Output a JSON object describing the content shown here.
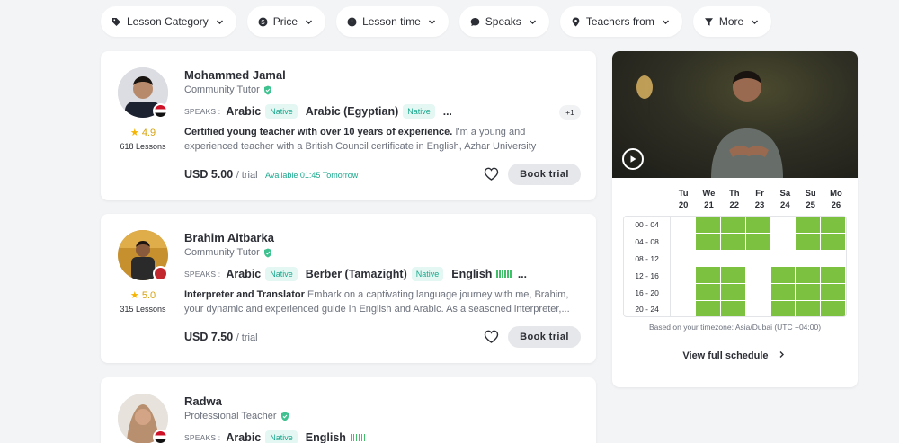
{
  "filters": [
    {
      "label": "Lesson Category",
      "icon": "tag-icon"
    },
    {
      "label": "Price",
      "icon": "coin-icon"
    },
    {
      "label": "Lesson time",
      "icon": "clock-icon"
    },
    {
      "label": "Speaks",
      "icon": "chat-icon"
    },
    {
      "label": "Teachers from",
      "icon": "location-pin-icon"
    },
    {
      "label": "More",
      "icon": "filter-icon"
    }
  ],
  "tutors": [
    {
      "name": "Mohammed Jamal",
      "type": "Community Tutor",
      "rating": "4.9",
      "lessons": "618 Lessons",
      "speaks_label": "SPEAKS :",
      "languages": [
        {
          "name": "Arabic",
          "level": "Native"
        },
        {
          "name": "Arabic (Egyptian)",
          "level": "Native"
        }
      ],
      "ellipsis": "...",
      "more_count": "+1",
      "headline": "Certified young teacher with over 10 years of experience.",
      "description": "I'm a young and experienced teacher with a British Council certificate in English, Azhar University graduation certifica...",
      "price": "USD 5.00",
      "price_unit": "/ trial",
      "availability": "Available 01:45 Tomorrow",
      "book_label": "Book trial"
    },
    {
      "name": "Brahim Aitbarka",
      "type": "Community Tutor",
      "rating": "5.0",
      "lessons": "315 Lessons",
      "speaks_label": "SPEAKS :",
      "languages": [
        {
          "name": "Arabic",
          "level": "Native"
        },
        {
          "name": "Berber (Tamazight)",
          "level": "Native"
        },
        {
          "name": "English",
          "level": ""
        }
      ],
      "ellipsis": "...",
      "headline": "Interpreter and Translator",
      "description": "Embark on a captivating language journey with me, Brahim, your dynamic and experienced guide in English and Arabic. As a seasoned interpreter,...",
      "price": "USD 7.50",
      "price_unit": "/ trial",
      "book_label": "Book trial"
    },
    {
      "name": "Radwa",
      "type": "Professional Teacher",
      "speaks_label": "SPEAKS :",
      "languages": [
        {
          "name": "Arabic",
          "level": "Native"
        },
        {
          "name": "English",
          "level": ""
        }
      ]
    }
  ],
  "schedule": {
    "days": [
      {
        "dow": "Tu",
        "date": "20"
      },
      {
        "dow": "We",
        "date": "21"
      },
      {
        "dow": "Th",
        "date": "22"
      },
      {
        "dow": "Fr",
        "date": "23"
      },
      {
        "dow": "Sa",
        "date": "24"
      },
      {
        "dow": "Su",
        "date": "25"
      },
      {
        "dow": "Mo",
        "date": "26"
      }
    ],
    "slots": [
      "00 - 04",
      "04 - 08",
      "08 - 12",
      "12 - 16",
      "16 - 20",
      "20 - 24"
    ],
    "availability": [
      [
        0,
        1,
        1,
        1,
        0,
        1,
        1
      ],
      [
        0,
        1,
        1,
        1,
        0,
        1,
        1
      ],
      [
        0,
        0,
        0,
        0,
        0,
        0,
        0
      ],
      [
        0,
        1,
        1,
        0,
        1,
        1,
        1
      ],
      [
        0,
        1,
        1,
        0,
        1,
        1,
        1
      ],
      [
        0,
        1,
        1,
        0,
        1,
        1,
        1
      ]
    ],
    "timezone_note": "Based on your timezone: Asia/Dubai (UTC +04:00)",
    "full_schedule_label": "View full schedule",
    "available_color": "#7dc140"
  }
}
